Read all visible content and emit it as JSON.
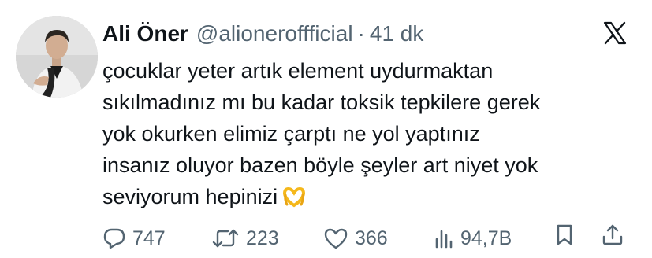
{
  "author": {
    "name": "Ali Öner",
    "handle": "@alioneroffficial",
    "separator": "·",
    "time": "41 dk"
  },
  "platform_icon": "x-logo-icon",
  "tweet_lines": [
    "çocuklar yeter artık element uydurmaktan",
    "sıkılmadınız mı bu kadar toksik tepkilere gerek",
    "yok okurken elimiz çarptı ne yol yaptınız",
    "insanız oluyor bazen böyle şeyler art niyet yok",
    "seviyorum hepinizi"
  ],
  "emoji": "heart-hands-emoji",
  "actions": {
    "replies": "747",
    "retweets": "223",
    "likes": "366",
    "views": "94,7B"
  },
  "icons": [
    "reply-icon",
    "retweet-icon",
    "like-icon",
    "views-icon",
    "bookmark-icon",
    "share-icon"
  ],
  "colors": {
    "text": "#0f1419",
    "muted": "#536471",
    "emoji": "#f5b81b"
  }
}
